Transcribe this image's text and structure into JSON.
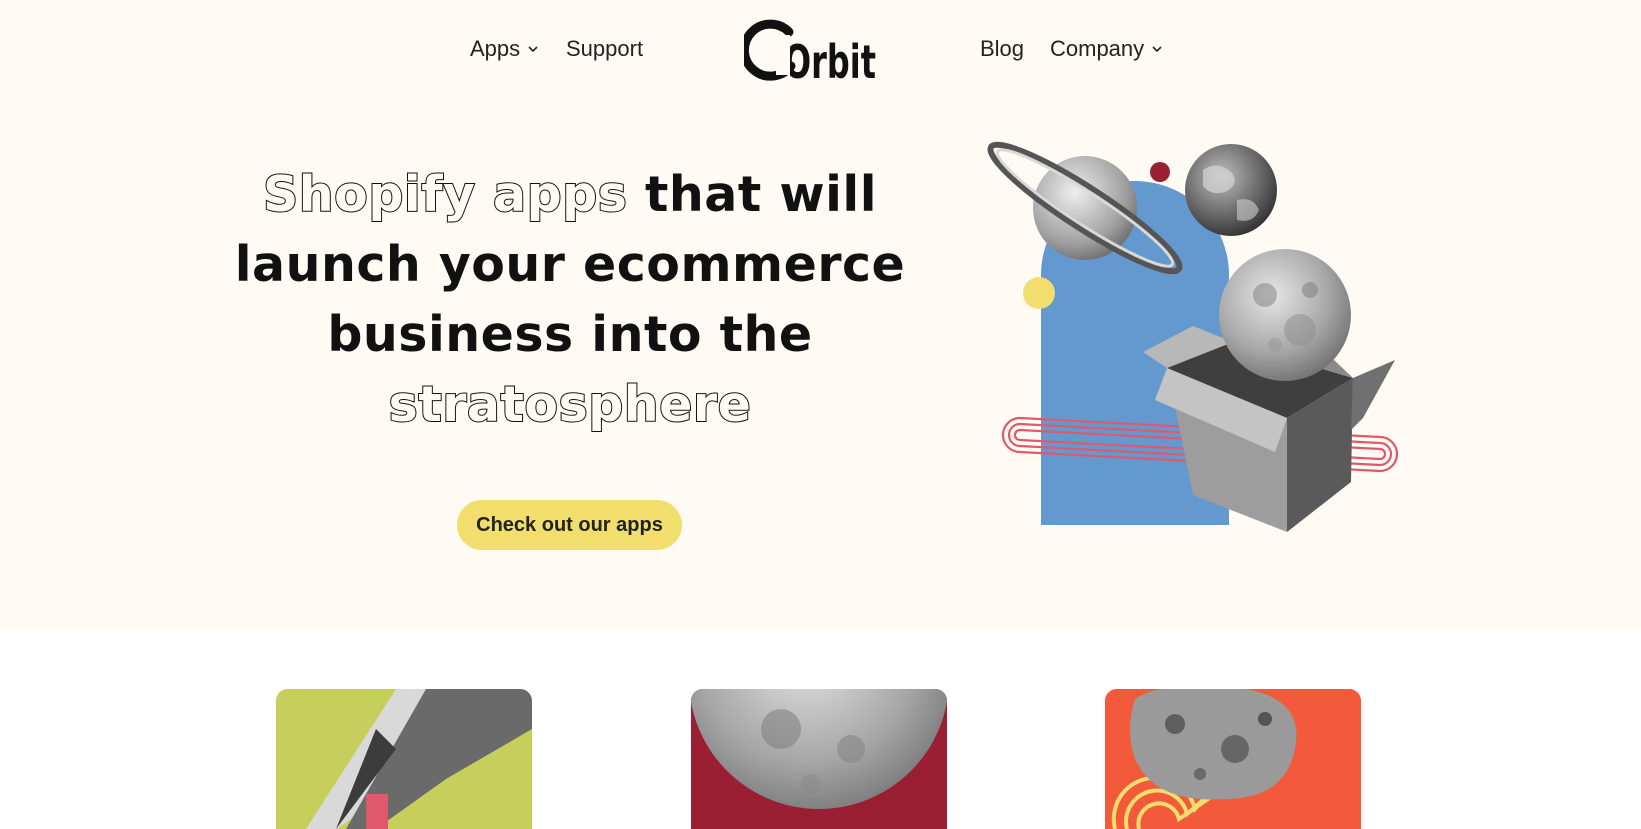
{
  "nav": {
    "apps": "Apps",
    "support": "Support",
    "logo": "Orbit",
    "blog": "Blog",
    "company": "Company"
  },
  "hero": {
    "headline_outline_1": "Shopify apps",
    "headline_solid_1": " that will",
    "headline_solid_2": "launch your ecommerce",
    "headline_solid_3": "business into the",
    "headline_outline_2": "stratosphere",
    "cta_label": "Check out our apps"
  },
  "colors": {
    "hero_background": "#fffaf3",
    "cta_yellow": "#f2de6c",
    "arch_blue": "#6399cf",
    "card_green": "#c6cf5c",
    "card_red": "#9b1f33",
    "card_orange": "#f25a3b",
    "stripe_pink": "#e0596b"
  },
  "icons": {
    "apps_chevron": "chevron-down-icon",
    "company_chevron": "chevron-down-icon"
  }
}
